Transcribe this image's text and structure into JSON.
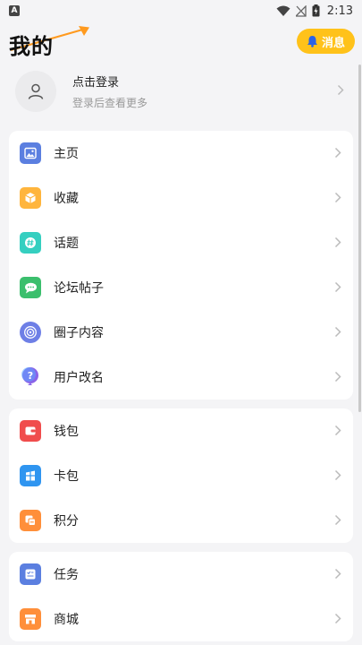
{
  "status_bar": {
    "time": "2:13",
    "app_badge": "A"
  },
  "header": {
    "title": "我的",
    "message_button": "消息"
  },
  "login": {
    "title": "点击登录",
    "subtitle": "登录后查看更多"
  },
  "group1": [
    {
      "label": "主页",
      "icon": "image-icon",
      "color": "#5b7fe0"
    },
    {
      "label": "收藏",
      "icon": "box-icon",
      "color": "#ffb53d"
    },
    {
      "label": "话题",
      "icon": "hashtag-icon",
      "color": "#35cfc0"
    },
    {
      "label": "论坛帖子",
      "icon": "chat-icon",
      "color": "#3bbf6d"
    },
    {
      "label": "圈子内容",
      "icon": "circle-icon",
      "color": "#6e7fe6"
    },
    {
      "label": "用户改名",
      "icon": "question-bubble-icon",
      "color": "#8a63e8"
    }
  ],
  "group2": [
    {
      "label": "钱包",
      "icon": "wallet-icon",
      "color": "#f04d4d"
    },
    {
      "label": "卡包",
      "icon": "card-icon",
      "color": "#2f95f0"
    },
    {
      "label": "积分",
      "icon": "points-icon",
      "color": "#ff8f3a"
    }
  ],
  "group3": [
    {
      "label": "任务",
      "icon": "task-icon",
      "color": "#5b7fe0"
    },
    {
      "label": "商城",
      "icon": "shop-icon",
      "color": "#ff8f3a"
    }
  ]
}
